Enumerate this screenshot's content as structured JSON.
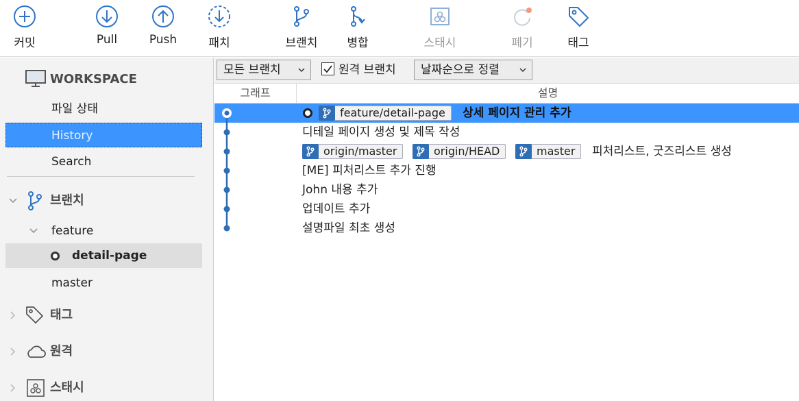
{
  "toolbar": {
    "commit": "커밋",
    "pull": "Pull",
    "push": "Push",
    "patch": "패치",
    "branch": "브랜치",
    "merge": "병합",
    "stash": "스태시",
    "discard": "폐기",
    "tag": "태그"
  },
  "sidebar": {
    "workspace": "WORKSPACE",
    "file_status": "파일 상태",
    "history": "History",
    "search": "Search",
    "branches": "브랜치",
    "feature": "feature",
    "detail_page": "detail-page",
    "master": "master",
    "tags": "태그",
    "remotes": "원격",
    "stashes": "스태시"
  },
  "filters": {
    "branch_filter": "모든 브랜치",
    "remote_branches": "원격 브랜치",
    "remote_branches_checked": true,
    "sort": "날짜순으로 정렬"
  },
  "columns": {
    "graph": "그래프",
    "description": "설명"
  },
  "commits": [
    {
      "tags": [
        "feature/detail-page"
      ],
      "message": "상세 페이지 관리 추가",
      "selected": true,
      "head": true
    },
    {
      "tags": [],
      "message": "디테일 페이지 생성 및 제목 작성"
    },
    {
      "tags": [
        "origin/master",
        "origin/HEAD",
        "master"
      ],
      "message": "피처리스트, 굿즈리스트 생성"
    },
    {
      "tags": [],
      "message": "[ME] 피처리스트 추가 진행"
    },
    {
      "tags": [],
      "message": "John 내용 추가"
    },
    {
      "tags": [],
      "message": "업데이트 추가"
    },
    {
      "tags": [],
      "message": "설명파일 최초 생성"
    }
  ],
  "colors": {
    "accent": "#3c95ff",
    "graph_line": "#2f6db5",
    "tag_icon_bg": "#2f6db5"
  }
}
